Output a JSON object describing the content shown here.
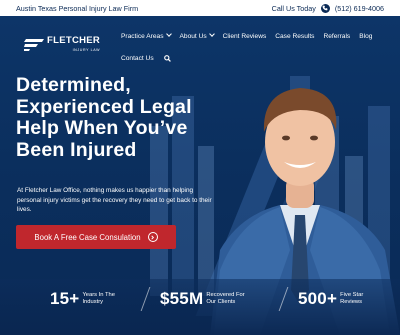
{
  "topbar": {
    "firm_name": "Austin Texas Personal Injury Law Firm",
    "call_label": "Call Us Today",
    "phone": "(512) 619-4006"
  },
  "logo": {
    "name": "FLETCHER",
    "tagline": "INJURY LAW"
  },
  "nav": {
    "items": [
      "Practice Areas",
      "About Us",
      "Client Reviews",
      "Case Results",
      "Referrals",
      "Blog",
      "Contact Us"
    ]
  },
  "hero": {
    "headline_lines": [
      "Determined,",
      "Experienced Legal",
      "Help When You’ve",
      "Been Injured"
    ],
    "subtext": "At Fletcher Law Office, nothing makes us happier than helping personal injury victims get the recovery they need to get back to their lives.",
    "cta_label": "Book A Free Case Consulation"
  },
  "stats": [
    {
      "value": "15+",
      "label": "Years In The Industry"
    },
    {
      "value": "$55M",
      "label": "Recovered For Our Clients"
    },
    {
      "value": "500+",
      "label": "Five Star Reviews"
    }
  ],
  "icons": [
    "phone-icon",
    "chevron-down-icon",
    "search-icon",
    "arrow-right-circle-icon"
  ],
  "colors": {
    "navy": "#0b2f5e",
    "accent_red": "#c0272d",
    "text_dark": "#0b2a55"
  }
}
